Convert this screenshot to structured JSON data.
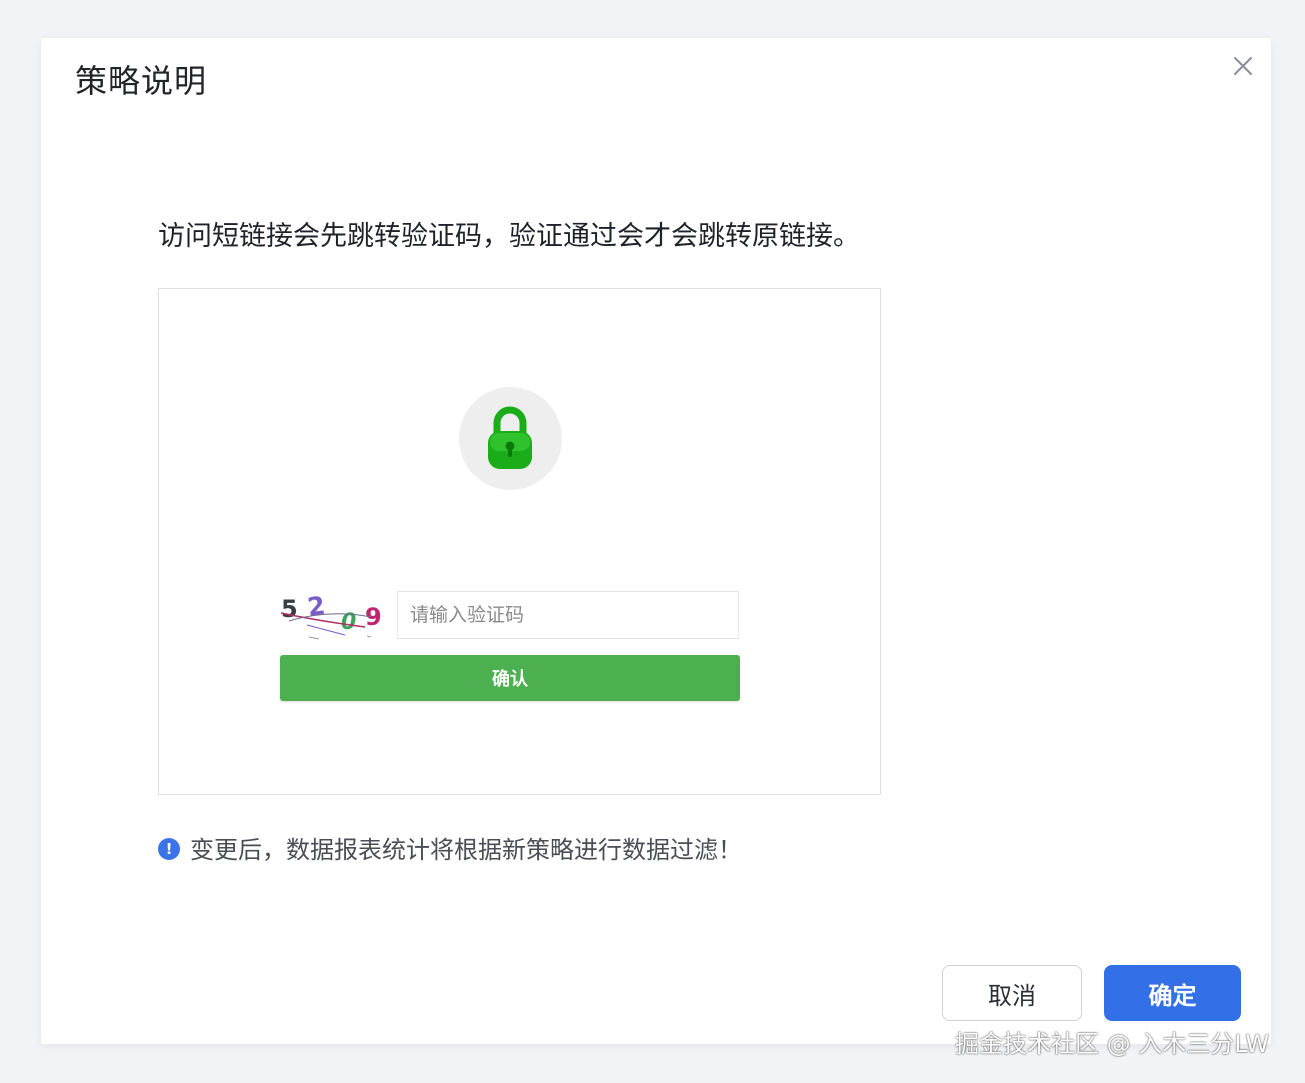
{
  "dialog": {
    "title": "策略说明",
    "description": "访问短链接会先跳转验证码，验证通过会才会跳转原链接。",
    "preview": {
      "captcha_text": "5209",
      "input_placeholder": "请输入验证码",
      "verify_label": "确认"
    },
    "notice": "变更后，数据报表统计将根据新策略进行数据过滤！",
    "cancel_label": "取消",
    "ok_label": "确定"
  },
  "icons": {
    "close": "close-icon",
    "lock": "lock-icon",
    "info": "info-icon"
  },
  "colors": {
    "primary": "#3370e8",
    "verify_green": "#4caf50",
    "lock_green": "#1aad19"
  },
  "watermark": "掘金技术社区 @ 入木三分LW"
}
